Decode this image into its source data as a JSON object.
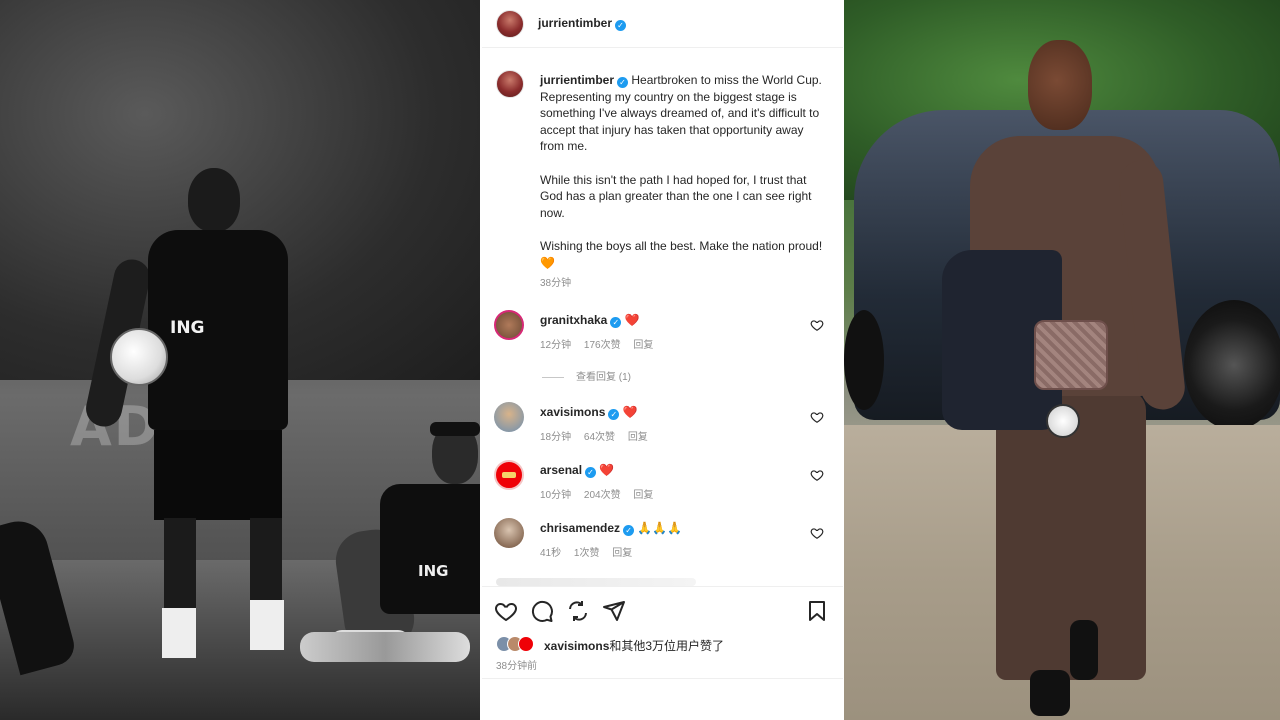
{
  "post": {
    "header_username": "jurrientimber",
    "caption_username": "jurrientimber",
    "caption_paragraphs": [
      "Heartbroken to miss the World Cup. Representing my country on the biggest stage is something I've always dreamed of, and it's difficult to accept that injury has taken that opportunity away from me.",
      "While this isn't the path I had hoped for, I trust that God has a plan greater than the one I can see right now.",
      "Wishing the boys all the best. Make the nation proud!"
    ],
    "caption_emoji": "🧡",
    "caption_time": "38分钟"
  },
  "comments": [
    {
      "username": "granitxhaka",
      "text": "❤️",
      "time": "12分钟",
      "likes": "176次赞",
      "reply": "回复"
    },
    {
      "username": "xavisimons",
      "text": "❤️",
      "time": "18分钟",
      "likes": "64次赞",
      "reply": "回复"
    },
    {
      "username": "arsenal",
      "text": "❤️",
      "time": "10分钟",
      "likes": "204次赞",
      "reply": "回复"
    },
    {
      "username": "chrisamendez",
      "text": "🙏🙏🙏",
      "time": "41秒",
      "likes": "1次赞",
      "reply": "回复"
    }
  ],
  "view_replies": "查看回复 (1)",
  "likes_summary": {
    "first_user": "xavisimons",
    "rest": "和其他3万位用户赞了"
  },
  "post_time": "38分钟前",
  "photo_text": {
    "left_shirt_sponsor_1": "ING",
    "left_shirt_sponsor_2": "ING",
    "left_board_text": "AD"
  },
  "colors": {
    "verified": "#1d9bf0",
    "heart": "#ed4956",
    "text": "#262626",
    "muted": "#8e8e8e"
  },
  "icons": {
    "like": "heart-outline-icon",
    "comment": "comment-icon",
    "repost": "repost-icon",
    "share": "send-icon",
    "save": "bookmark-icon"
  }
}
